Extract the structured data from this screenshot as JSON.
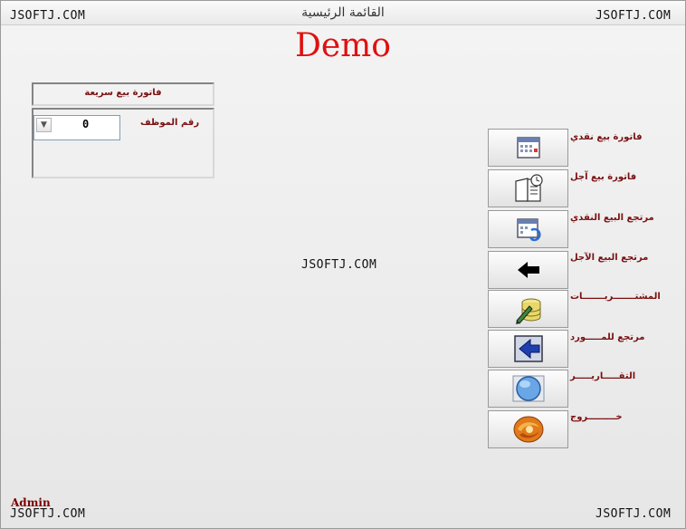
{
  "window": {
    "title": "القائمة الرئيسية",
    "brand_heading": "Demo"
  },
  "watermarks": {
    "top_left": "JSOFTJ.COM",
    "top_right": "JSOFTJ.COM",
    "center": "JSOFTJ.COM",
    "bottom_left": "JSOFTJ.COM",
    "bottom_right": "JSOFTJ.COM"
  },
  "quick_sale": {
    "header": "فاتورة بيع سريعة",
    "employee_label": "رقم الموظف",
    "employee_value": "0"
  },
  "menu": [
    {
      "label": "فاتورة بيع نقدي",
      "icon": "calendar-grid-icon"
    },
    {
      "label": "فاتورة بيع آجل",
      "icon": "book-clock-icon"
    },
    {
      "label": "مرتجع البيع النقدي",
      "icon": "calendar-refresh-icon"
    },
    {
      "label": "مرتجع البيع الآجل",
      "icon": "arrow-left-icon"
    },
    {
      "label": "المشتـــــــريـــــــات",
      "icon": "database-pencil-icon"
    },
    {
      "label": "مرتجع للمـــــورد",
      "icon": "arrow-left-box-icon"
    },
    {
      "label": "التقـــــاريـــــر",
      "icon": "globe-report-icon"
    },
    {
      "label": "خـــــــــروج",
      "icon": "exit-swirl-icon"
    }
  ],
  "footer": {
    "user": "Admin"
  }
}
